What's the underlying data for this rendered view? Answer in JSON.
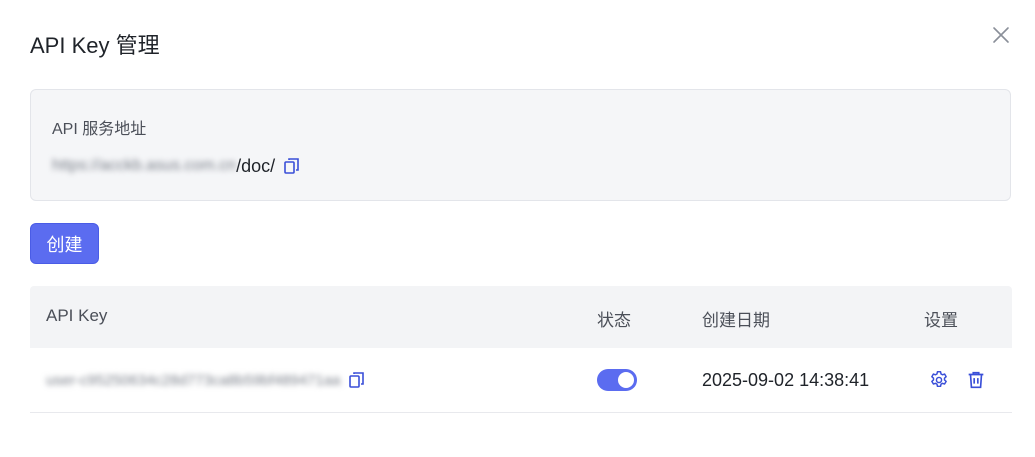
{
  "dialog": {
    "title": "API Key 管理",
    "close_icon": "close-icon"
  },
  "service": {
    "label": "API 服务地址",
    "url_hidden": "https://acckb.asus.com.cn",
    "url_visible": "/doc/",
    "copy_icon": "copy-icon"
  },
  "create_button": "创建",
  "table": {
    "columns": {
      "key": "API Key",
      "status": "状态",
      "created": "创建日期",
      "settings": "设置"
    },
    "rows": [
      {
        "key": "user-c95250634c28d773ca8b59bf489471aa",
        "status_enabled": true,
        "created": "2025-09-02 14:38:41"
      }
    ]
  },
  "colors": {
    "accent": "#5b6cf0",
    "icon_blue": "#3a4fd8"
  }
}
